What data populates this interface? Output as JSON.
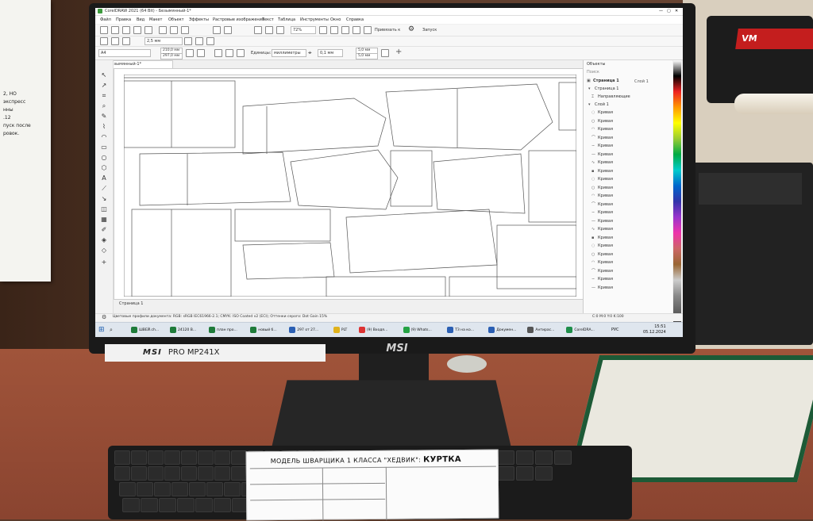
{
  "notice": {
    "lines": [
      "2, НО",
      "экспресс",
      "нны",
      ".12",
      "",
      "пуск после",
      "ровок."
    ]
  },
  "plotter": {
    "label": "VM"
  },
  "monitor": {
    "brand_logo": "MSI",
    "model": "PRO MP241X",
    "bezel_logo": "MSI"
  },
  "app": {
    "title": "CorelDRAW 2021 (64 Bit) - Безымянный-1*",
    "menu": [
      "Файл",
      "Правка",
      "Вид",
      "Макет",
      "Объект",
      "Эффекты",
      "Растровые изображения",
      "Текст",
      "Таблица",
      "Инструменты",
      "Окно",
      "Справка"
    ],
    "toolbar": {
      "zoom": "72%",
      "snap_label": "Привязать к",
      "launch_label": "Запуск"
    },
    "propbar": {
      "page_size": "A4",
      "width": "210,0 мм",
      "height": "297,0 мм",
      "units_label": "Единицы:",
      "units": "миллиметры",
      "nudge": "0,1 мм",
      "dup_x": "5,0 мм",
      "dup_y": "5,0 мм",
      "outline": "2,5 мм"
    },
    "doc_tab": "Безымянный-1*",
    "page_tab": "Страница 1",
    "docker": {
      "title": "Объекты",
      "search": "Поиск",
      "page": "Страница 1",
      "layer_tab": "Слой 1",
      "guides": "Направляющие",
      "layer": "Слой 1",
      "item_label": "Кривая",
      "item_count": 22
    },
    "status": "Цветовые профили документа: RGB: sRGB IEC61966-2.1; CMYK: ISO Coated v2 (ECI); Оттенки серого: Dot Gain 15%",
    "cmyk": "C:0 M:0 Y:0 K:100"
  },
  "taskbar": {
    "items": [
      {
        "label": "ШВЕЙ.сh...",
        "color": "#1e7b3a"
      },
      {
        "label": "24120 B...",
        "color": "#1e7b3a"
      },
      {
        "label": "план про...",
        "color": "#1e7b3a"
      },
      {
        "label": "новый б...",
        "color": "#1e7b3a"
      },
      {
        "label": "297 от 27...",
        "color": "#2b5fb3"
      },
      {
        "label": "PLT",
        "color": "#e0b21c"
      },
      {
        "label": "(9) Входя...",
        "color": "#d33"
      },
      {
        "label": "(9) Whats...",
        "color": "#25a244"
      },
      {
        "label": "ТЗ на ко...",
        "color": "#2b5fb3"
      },
      {
        "label": "Докумен...",
        "color": "#2b5fb3"
      },
      {
        "label": "Антирас...",
        "color": "#555"
      },
      {
        "label": "CorelDRA...",
        "color": "#1e8e4a"
      }
    ],
    "lang": "РУС",
    "time": "15:51",
    "date": "05.12.2024"
  },
  "paper": {
    "title_prefix": "МОДЕЛЬ ШВАРЩИКА 1 КЛАССА \"ХЕДВИК\":",
    "title_bold": "КУРТКА"
  }
}
